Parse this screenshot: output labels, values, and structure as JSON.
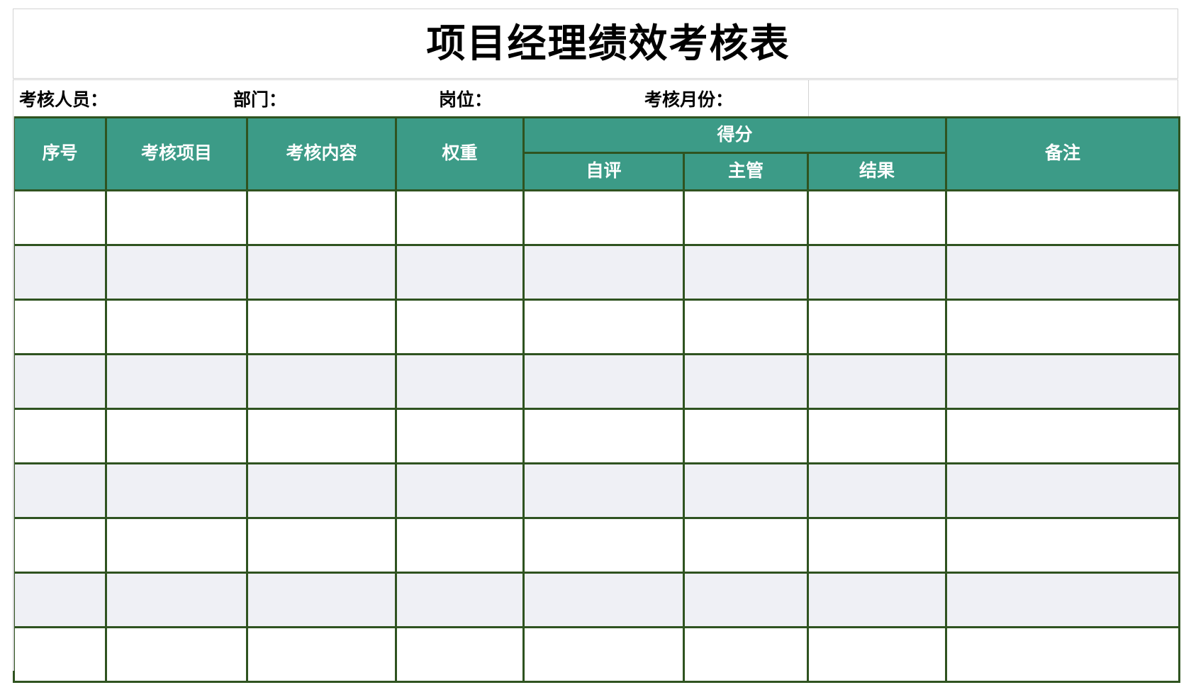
{
  "document": {
    "title": "项目经理绩效考核表"
  },
  "info_row": {
    "fields": [
      {
        "label": "考核人员：",
        "value": ""
      },
      {
        "label": "部门：",
        "value": ""
      },
      {
        "label": "岗位：",
        "value": ""
      },
      {
        "label": "考核月份：",
        "value": ""
      }
    ],
    "blank_cell": ""
  },
  "table": {
    "headers": {
      "index": "序号",
      "item": "考核项目",
      "content": "考核内容",
      "weight": "权重",
      "score_group": "得分",
      "self": "自评",
      "supervisor": "主管",
      "result": "结果",
      "remark": "备注"
    },
    "rows": [
      {
        "index": "",
        "item": "",
        "content": "",
        "weight": "",
        "self": "",
        "supervisor": "",
        "result": "",
        "remark": ""
      },
      {
        "index": "",
        "item": "",
        "content": "",
        "weight": "",
        "self": "",
        "supervisor": "",
        "result": "",
        "remark": ""
      },
      {
        "index": "",
        "item": "",
        "content": "",
        "weight": "",
        "self": "",
        "supervisor": "",
        "result": "",
        "remark": ""
      },
      {
        "index": "",
        "item": "",
        "content": "",
        "weight": "",
        "self": "",
        "supervisor": "",
        "result": "",
        "remark": ""
      },
      {
        "index": "",
        "item": "",
        "content": "",
        "weight": "",
        "self": "",
        "supervisor": "",
        "result": "",
        "remark": ""
      },
      {
        "index": "",
        "item": "",
        "content": "",
        "weight": "",
        "self": "",
        "supervisor": "",
        "result": "",
        "remark": ""
      },
      {
        "index": "",
        "item": "",
        "content": "",
        "weight": "",
        "self": "",
        "supervisor": "",
        "result": "",
        "remark": ""
      },
      {
        "index": "",
        "item": "",
        "content": "",
        "weight": "",
        "self": "",
        "supervisor": "",
        "result": "",
        "remark": ""
      },
      {
        "index": "",
        "item": "",
        "content": "",
        "weight": "",
        "self": "",
        "supervisor": "",
        "result": "",
        "remark": ""
      }
    ]
  },
  "colors": {
    "header_green": "#3c9b87",
    "grid_border": "#2f5320",
    "alt_row": "#eff0f5",
    "outline_gray": "#d3d3d3",
    "text": "#000000",
    "header_text": "#ffffff"
  }
}
